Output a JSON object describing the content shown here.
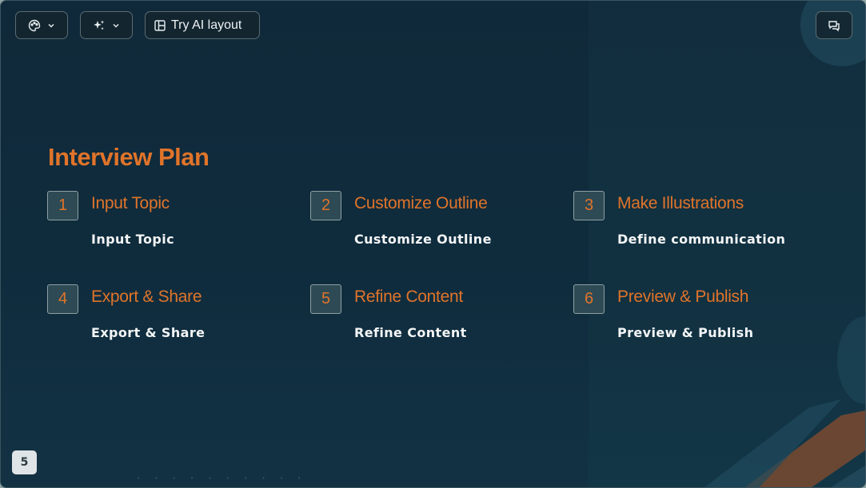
{
  "toolbar": {
    "theme_icon": "palette-icon",
    "ai_icon": "sparkles-icon",
    "layout_icon": "layout-icon",
    "layout_label": "Try AI layout",
    "comment_icon": "comments-icon",
    "chevron_icon": "chevron-down-icon"
  },
  "slide": {
    "title": "Interview Plan",
    "steps": [
      {
        "number": "1",
        "heading": "Input Topic",
        "description": "Input Topic"
      },
      {
        "number": "2",
        "heading": "Customize Outline",
        "description": "Customize Outline"
      },
      {
        "number": "3",
        "heading": "Make Illustrations",
        "description": "Define communication"
      },
      {
        "number": "4",
        "heading": "Export & Share",
        "description": "Export & Share"
      },
      {
        "number": "5",
        "heading": "Refine Content",
        "description": "Refine Content"
      },
      {
        "number": "6",
        "heading": "Preview & Publish",
        "description": "Preview & Publish"
      }
    ],
    "colors": {
      "accent": "#e0742a",
      "background": "#10293a",
      "text": "#f3f5f6"
    }
  },
  "footer": {
    "page_number": "5"
  }
}
